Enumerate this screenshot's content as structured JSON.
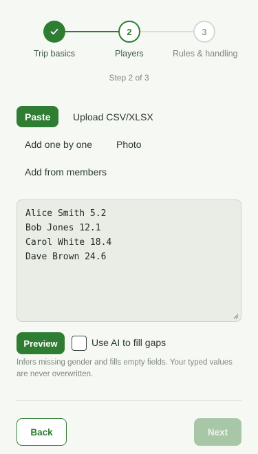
{
  "stepper": {
    "steps": [
      {
        "number": "1",
        "label": "Trip basics",
        "state": "complete",
        "icon": "check-icon"
      },
      {
        "number": "2",
        "label": "Players",
        "state": "current"
      },
      {
        "number": "3",
        "label": "Rules & handling",
        "state": "upcoming"
      }
    ],
    "step_count": "Step 2 of 3"
  },
  "input_tabs": [
    {
      "label": "Paste",
      "selected": true
    },
    {
      "label": "Upload CSV/XLSX",
      "selected": false
    },
    {
      "label": "Add one by one",
      "selected": false
    },
    {
      "label": "Photo",
      "selected": false
    },
    {
      "label": "Add from members",
      "selected": false
    }
  ],
  "paste_area": {
    "value": "Alice Smith 5.2\nBob Jones 12.1\nCarol White 18.4\nDave Brown 24.6"
  },
  "actions": {
    "preview_label": "Preview",
    "ai_fill_label": "Use AI to fill gaps",
    "ai_fill_checked": false,
    "hint": "Infers missing gender and fills empty fields. Your typed values are never overwritten."
  },
  "footer": {
    "back_label": "Back",
    "next_label": "Next",
    "next_enabled": false
  },
  "colors": {
    "accent": "#2e7d32",
    "background": "#f6f8f4",
    "disabled_button": "#a8c7a6"
  }
}
